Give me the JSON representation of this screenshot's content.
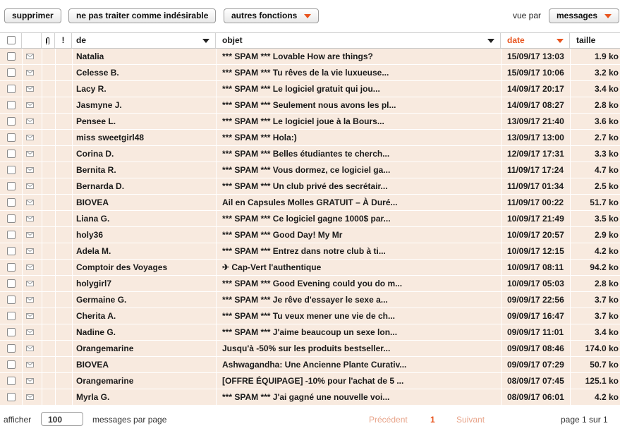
{
  "toolbar": {
    "delete_label": "supprimer",
    "not_spam_label": "ne pas traiter comme indésirable",
    "other_label": "autres fonctions",
    "view_by_label": "vue par",
    "view_by_value": "messages"
  },
  "columns": {
    "from": "de",
    "subject": "objet",
    "date": "date",
    "size": "taille"
  },
  "rows": [
    {
      "from": "Natalia",
      "subject": "*** SPAM *** Lovable How are things?",
      "date": "15/09/17 13:03",
      "size": "1.9 ko"
    },
    {
      "from": "Celesse B.",
      "subject": "*** SPAM *** Tu rêves de la vie luxueuse...",
      "date": "15/09/17 10:06",
      "size": "3.2 ko"
    },
    {
      "from": "Lacy R.",
      "subject": "*** SPAM *** Le logiciel gratuit qui jou...",
      "date": "14/09/17 20:17",
      "size": "3.4 ko"
    },
    {
      "from": "Jasmyne J.",
      "subject": "*** SPAM *** Seulement nous avons les pl...",
      "date": "14/09/17 08:27",
      "size": "2.8 ko"
    },
    {
      "from": "Pensee L.",
      "subject": "*** SPAM *** Le logiciel joue à la Bours...",
      "date": "13/09/17 21:40",
      "size": "3.6 ko"
    },
    {
      "from": "miss sweetgirl48",
      "subject": "*** SPAM *** Hola:)",
      "date": "13/09/17 13:00",
      "size": "2.7 ko"
    },
    {
      "from": "Corina D.",
      "subject": "*** SPAM *** Belles étudiantes te cherch...",
      "date": "12/09/17 17:31",
      "size": "3.3 ko"
    },
    {
      "from": "Bernita R.",
      "subject": "*** SPAM *** Vous dormez, ce logiciel ga...",
      "date": "11/09/17 17:24",
      "size": "4.7 ko"
    },
    {
      "from": "Bernarda D.",
      "subject": "*** SPAM *** Un club privé des secrétair...",
      "date": "11/09/17 01:34",
      "size": "2.5 ko"
    },
    {
      "from": "BIOVEA",
      "subject": "Ail en Capsules Molles GRATUIT – À Duré...",
      "date": "11/09/17 00:22",
      "size": "51.7 ko"
    },
    {
      "from": "Liana G.",
      "subject": "*** SPAM *** Ce logiciel gagne 1000$ par...",
      "date": "10/09/17 21:49",
      "size": "3.5 ko"
    },
    {
      "from": "holy36",
      "subject": "*** SPAM *** Good Day! My Mr",
      "date": "10/09/17 20:57",
      "size": "2.9 ko"
    },
    {
      "from": "Adela M.",
      "subject": "*** SPAM *** Entrez dans notre club à ti...",
      "date": "10/09/17 12:15",
      "size": "4.2 ko"
    },
    {
      "from": "Comptoir des Voyages",
      "subject": "✈ Cap-Vert l'authentique",
      "date": "10/09/17 08:11",
      "size": "94.2 ko"
    },
    {
      "from": "holygirl7",
      "subject": "*** SPAM *** Good Evening could you do m...",
      "date": "10/09/17 05:03",
      "size": "2.8 ko"
    },
    {
      "from": "Germaine G.",
      "subject": "*** SPAM *** Je rêve d'essayer le sexe a...",
      "date": "09/09/17 22:56",
      "size": "3.7 ko"
    },
    {
      "from": "Cherita A.",
      "subject": "*** SPAM *** Tu veux mener une vie de ch...",
      "date": "09/09/17 16:47",
      "size": "3.7 ko"
    },
    {
      "from": "Nadine G.",
      "subject": "*** SPAM *** J'aime beaucoup un sexe lon...",
      "date": "09/09/17 11:01",
      "size": "3.4 ko"
    },
    {
      "from": "Orangemarine",
      "subject": "Jusqu'à -50% sur les produits bestseller...",
      "date": "09/09/17 08:46",
      "size": "174.0 ko"
    },
    {
      "from": "BIOVEA",
      "subject": "Ashwagandha: Une Ancienne Plante Curativ...",
      "date": "09/09/17 07:29",
      "size": "50.7 ko"
    },
    {
      "from": "Orangemarine",
      "subject": "[OFFRE ÉQUIPAGE] -10% pour l'achat de 5 ...",
      "date": "08/09/17 07:45",
      "size": "125.1 ko"
    },
    {
      "from": "Myrla G.",
      "subject": "*** SPAM *** J'ai gagné une nouvelle voi...",
      "date": "08/09/17 06:01",
      "size": "4.2 ko"
    }
  ],
  "footer": {
    "show_label": "afficher",
    "per_page_value": "100",
    "per_page_label": "messages par page",
    "prev_label": "Précédent",
    "current_page": "1",
    "next_label": "Suivant",
    "page_info": "page 1 sur 1"
  },
  "colors": {
    "accent": "#e8541e",
    "row_background": "#f8eadf"
  },
  "icons": {
    "attachment": "paperclip-icon",
    "priority": "exclamation-icon",
    "read_status": "envelope-icon",
    "dropdown": "chevron-down-icon"
  }
}
